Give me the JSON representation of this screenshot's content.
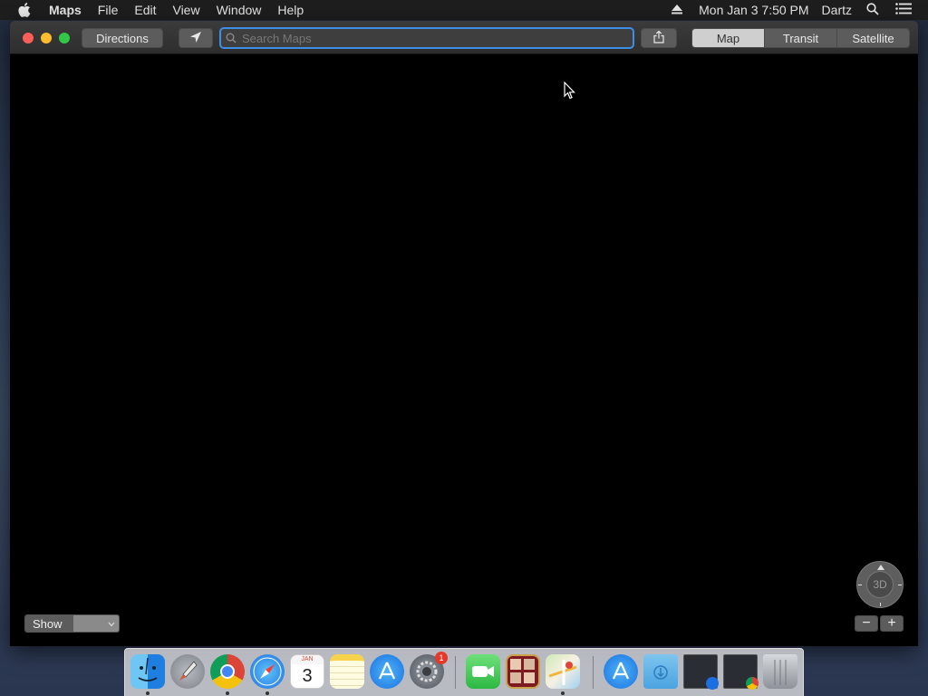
{
  "menubar": {
    "items": [
      "Maps",
      "File",
      "Edit",
      "View",
      "Window",
      "Help"
    ],
    "clock": "Mon Jan 3  7:50 PM",
    "user": "Dartz"
  },
  "toolbar": {
    "directions_label": "Directions",
    "search_placeholder": "Search Maps",
    "view_modes": [
      "Map",
      "Transit",
      "Satellite"
    ],
    "active_view_mode": "Map"
  },
  "map": {
    "show_label": "Show",
    "compass_label": "3D",
    "compass_north": "N",
    "zoom_out": "−",
    "zoom_in": "+"
  },
  "dock": {
    "calendar_month": "JAN",
    "calendar_day": "3",
    "system_prefs_badge": "1",
    "items": [
      "finder-icon",
      "launchpad-icon",
      "chrome-icon",
      "safari-icon",
      "calendar-icon",
      "notes-icon",
      "app-store-icon",
      "system-preferences-icon",
      "facetime-icon",
      "photo-booth-icon",
      "maps-icon",
      "app-store-folder-icon",
      "downloads-folder-icon",
      "window-preview-safari-icon",
      "window-preview-chrome-icon",
      "trash-icon"
    ]
  },
  "colors": {
    "accent": "#3f8ee6",
    "close": "#fc5f57",
    "minimize": "#fdbc2e",
    "maximize": "#33c748"
  }
}
